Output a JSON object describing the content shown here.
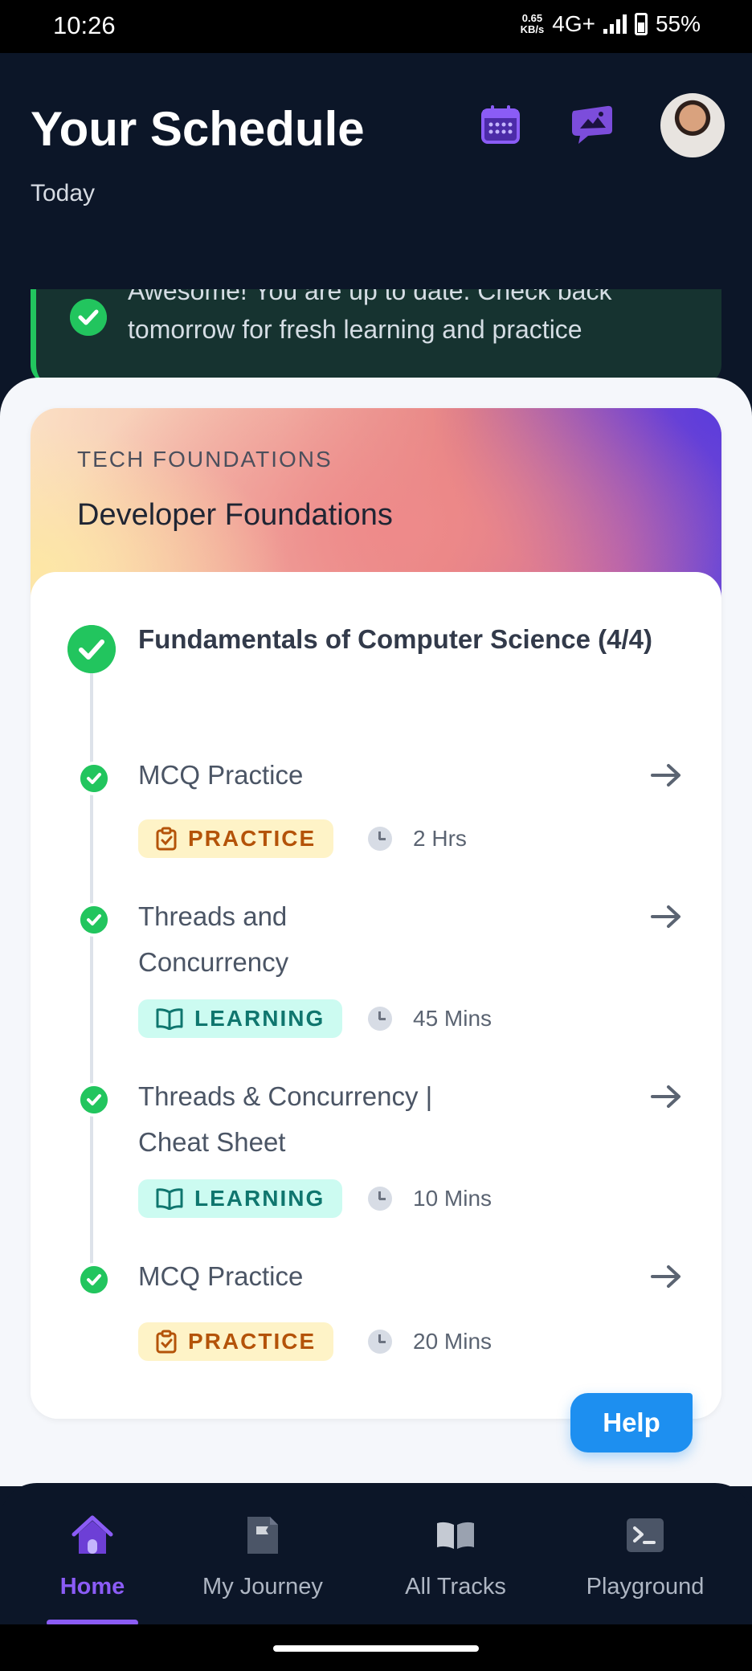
{
  "status_bar": {
    "time": "10:26",
    "net_speed_value": "0.65",
    "net_speed_unit": "KB/s",
    "network": "4G+",
    "battery": "55%"
  },
  "header": {
    "title": "Your Schedule",
    "subtitle": "Today",
    "icons": [
      "calendar-icon",
      "feedback-icon"
    ]
  },
  "banner": {
    "message": "Awesome! You are up to date. Check back tomorrow for fresh learning and practice"
  },
  "track_card": {
    "eyebrow": "TECH FOUNDATIONS",
    "title": "Developer Foundations",
    "module": {
      "title": "Fundamentals of Computer Science (4/4)"
    },
    "items": [
      {
        "title": "MCQ Practice",
        "type": "PRACTICE",
        "duration": "2 Hrs"
      },
      {
        "title": "Threads and Concurrency",
        "type": "LEARNING",
        "duration": "45 Mins"
      },
      {
        "title": "Threads & Concurrency | Cheat Sheet",
        "type": "LEARNING",
        "duration": "10 Mins"
      },
      {
        "title": "MCQ Practice",
        "type": "PRACTICE",
        "duration": "20 Mins"
      }
    ]
  },
  "help_button": "Help",
  "bottom_nav": [
    {
      "label": "Home",
      "icon": "home-icon",
      "active": true
    },
    {
      "label": "My Journey",
      "icon": "journey-flag-icon",
      "active": false
    },
    {
      "label": "All Tracks",
      "icon": "book-icon",
      "active": false
    },
    {
      "label": "Playground",
      "icon": "terminal-icon",
      "active": false
    }
  ],
  "colors": {
    "accent": "#8b5cf6",
    "success": "#22c55e",
    "help": "#1d8ff0",
    "background_dark": "#0c1628"
  }
}
